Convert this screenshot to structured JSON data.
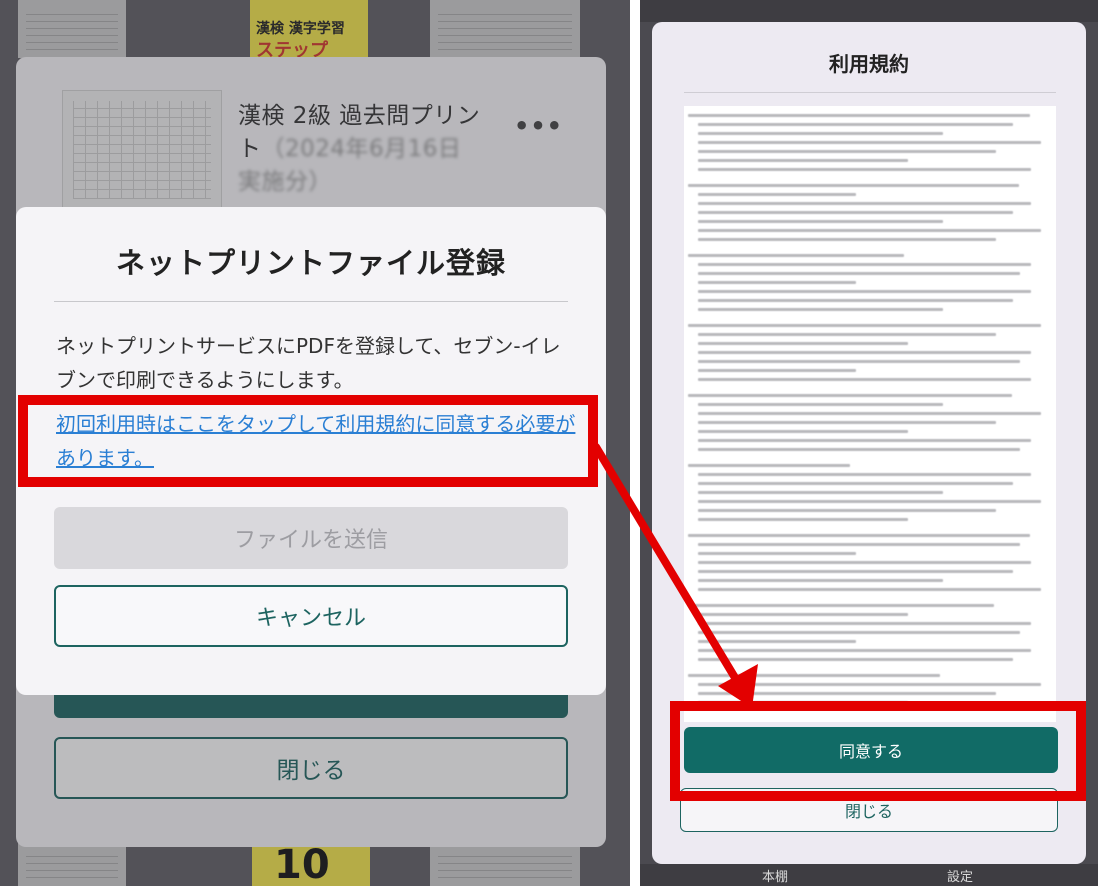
{
  "left": {
    "background": {
      "book_top_label": "漢検 漢字学習",
      "book_top_sublabel": "ステップ",
      "book_bottom_number": "10"
    },
    "file_item": {
      "title_main": "漢検 2級 過去問プリント",
      "title_blurred": "（2024年6月16日実施分）",
      "more_icon": "ellipsis-icon"
    },
    "close_button_label": "閉じる",
    "dialog": {
      "title": "ネットプリントファイル登録",
      "description": "ネットプリントサービスにPDFを登録して、セブン-イレブンで印刷できるようにします。",
      "terms_link": "初回利用時はここをタップして利用規約に同意する必要があります。",
      "send_button": "ファイルを送信",
      "cancel_button": "キャンセル"
    }
  },
  "right": {
    "terms_title": "利用規約",
    "agree_button": "同意する",
    "close_button": "閉じる",
    "tabs": [
      "本棚",
      "設定"
    ]
  },
  "colors": {
    "accent_teal": "#1d6460",
    "link_blue": "#2a7fd4",
    "annotation_red": "#e30000"
  }
}
